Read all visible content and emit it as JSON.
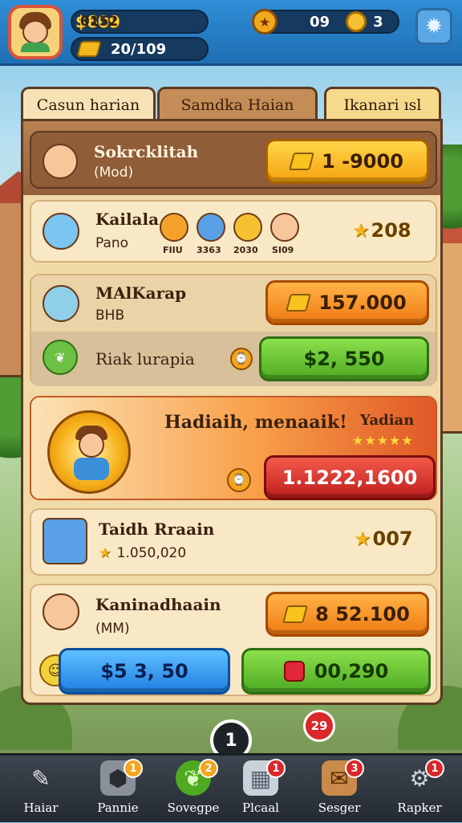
{
  "topbar": {
    "coins": "$609",
    "coins_sub": "0152",
    "gems": "20/109",
    "energy": "09",
    "energy_count": "3"
  },
  "tabs": [
    {
      "label": "Casun harian"
    },
    {
      "label": "Samdka Haian"
    },
    {
      "label": "Ikanari ısl"
    }
  ],
  "rows": {
    "r1": {
      "title": "Sokrcklitah",
      "sub": "(Mod)",
      "button": "1 -9000"
    },
    "r2": {
      "title": "Kailala",
      "sub": "Pano",
      "stars": "208",
      "mini": [
        "FIIU",
        "3363",
        "2030",
        "SI09"
      ]
    },
    "r3": {
      "title": "MAlKarap",
      "sub": "BHB",
      "button": "157.000",
      "row2_title": "Riak lurapia",
      "row2_button": "$2, 550"
    },
    "r4": {
      "title": "Hadiaih, menaaik!",
      "badge": "Yadian",
      "button": "1.1222,1600"
    },
    "r5": {
      "title": "Taidh Rraain",
      "sub": "1.050,020",
      "stars": "007"
    },
    "r6": {
      "title": "Kaninadhaain",
      "sub": "(MM)",
      "button": "8 52.100",
      "left_button": "$5 3, 50",
      "right_button": "00,290"
    }
  },
  "floating": {
    "badge": "29",
    "center": "1"
  },
  "nav": [
    {
      "label": "Haiar",
      "badge": ""
    },
    {
      "label": "Pannie",
      "badge": "1"
    },
    {
      "label": "Sovegpe",
      "badge": "2"
    },
    {
      "label": "Plcaal",
      "badge": "1"
    },
    {
      "label": "Sesger",
      "badge": "3"
    },
    {
      "label": "Rapker",
      "badge": "1"
    }
  ]
}
